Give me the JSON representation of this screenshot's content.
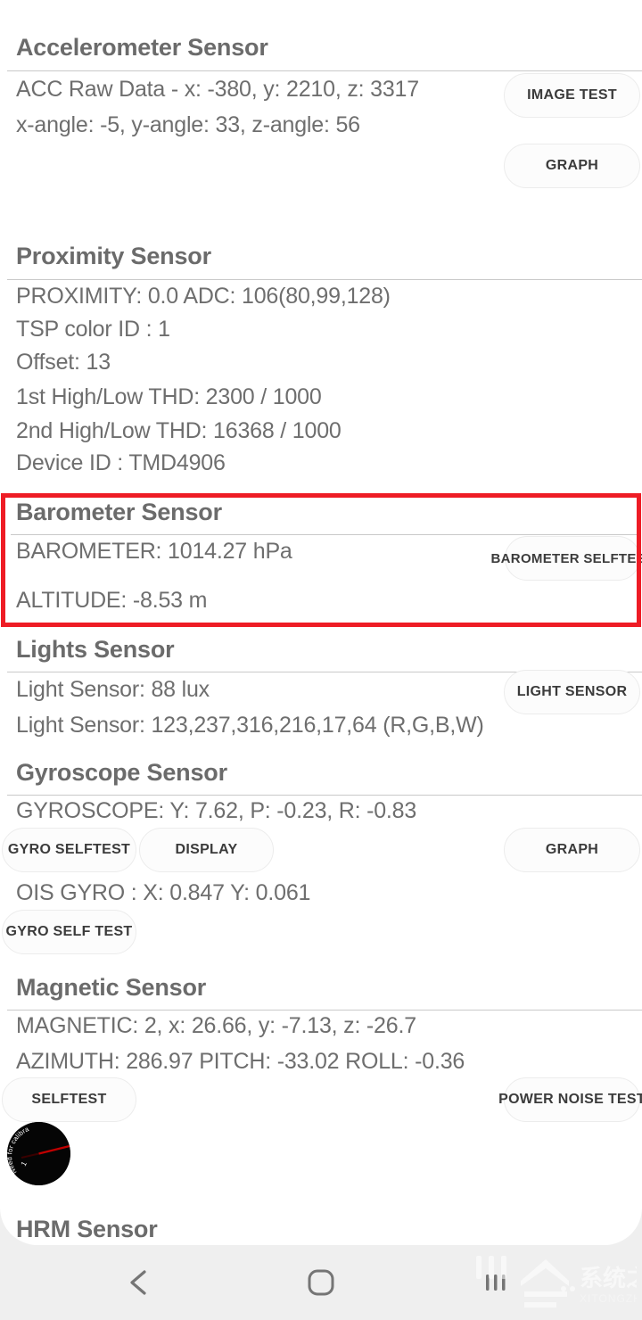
{
  "app": {
    "background_color": "#efefef",
    "card_color": "#ffffff",
    "highlight_color": "#ee1c25",
    "text_color": "#6e6e6e",
    "heading_color": "#6b6b6b"
  },
  "sections": {
    "accelerometer": {
      "title": "Accelerometer Sensor",
      "raw": "ACC Raw Data - x: -380, y: 2210, z: 3317",
      "angle": "x-angle: -5, y-angle: 33, z-angle: 56",
      "btn_image_test": "IMAGE TEST",
      "btn_graph": "GRAPH"
    },
    "proximity": {
      "title": "Proximity Sensor",
      "proximity": "PROXIMITY: 0.0     ADC: 106(80,99,128)",
      "tsp_color_id": "TSP color ID : 1",
      "offset": "Offset: 13",
      "thd_1st": "1st High/Low THD: 2300 / 1000",
      "thd_2nd": "2nd High/Low THD: 16368 / 1000",
      "device_id": "Device ID : TMD4906"
    },
    "barometer": {
      "title": "Barometer Sensor",
      "pressure": "BAROMETER: 1014.27 hPa",
      "altitude": "ALTITUDE: -8.53 m",
      "btn_selftest": "BAROMETER SELFTEST",
      "highlighted": true
    },
    "lights": {
      "title": "Lights Sensor",
      "lux": "Light Sensor: 88 lux",
      "rgbw": "Light Sensor: 123,237,316,216,17,64 (R,G,B,W)",
      "btn_light_sensor": "LIGHT SENSOR"
    },
    "gyroscope": {
      "title": "Gyroscope Sensor",
      "values": "GYROSCOPE: Y: 7.62, P: -0.23, R: -0.83",
      "btn_gyro_selftest": "GYRO SELFTEST",
      "btn_display": "DISPLAY",
      "btn_graph": "GRAPH",
      "ois": "OIS GYRO : X: 0.847 Y: 0.061",
      "btn_gyro_self_test": "GYRO SELF TEST"
    },
    "magnetic": {
      "title": "Magnetic Sensor",
      "magnetic": "MAGNETIC: 2, x: 26.66, y: -7.13, z: -26.7",
      "orientation": "AZIMUTH: 286.97   PITCH: -33.02   ROLL: -0.36",
      "btn_selftest": "SELFTEST",
      "btn_power_noise_test": "POWER NOISE TEST",
      "compass_label": "Need for calibration"
    },
    "hrm": {
      "title": "HRM Sensor"
    }
  },
  "navbar": {
    "back": "back-icon",
    "home": "home-icon",
    "recents": "recent-apps-icon"
  },
  "watermark": {
    "text_cn": "系统之家",
    "text_en": "XITONGZHIJIA.NET"
  }
}
